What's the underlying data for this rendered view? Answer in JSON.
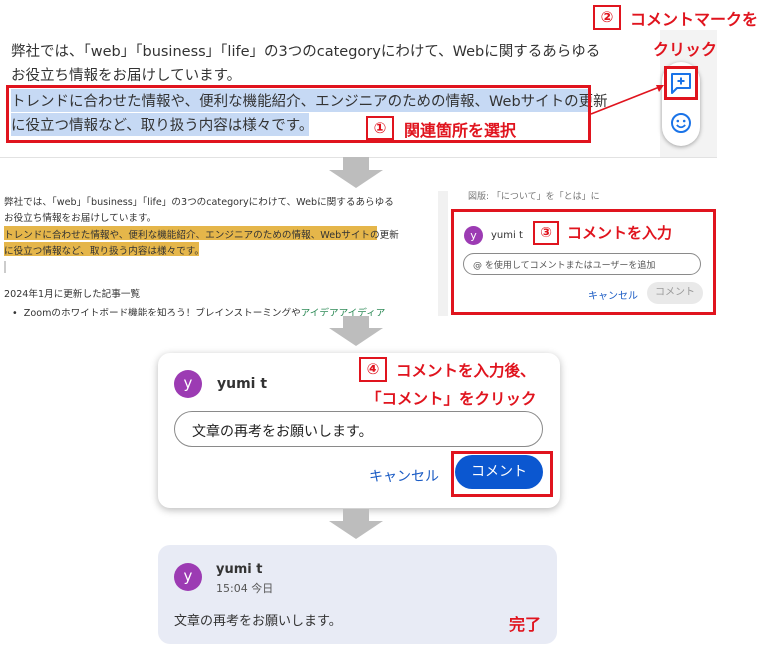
{
  "step1": {
    "line1": "弊社では、「web」「business」「life」の3つのcategoryにわけて、Webに関するあらゆる",
    "line2": "お役立ち情報をお届けしています。",
    "sel1": "トレンドに合わせた情報や、便利な機能紹介、エンジニアのための情報、Webサイトの更新",
    "sel2": "に役立つ情報など、取り扱う内容は様々です。",
    "callout_num": "①",
    "callout_text": "関連箇所を選択",
    "comment_icon": "add-comment-icon",
    "emoji_icon": "emoji-icon"
  },
  "step2": {
    "callout_num": "②",
    "callout_line1": "コメントマークを",
    "callout_line2": "クリック"
  },
  "step3": {
    "line1": "弊社では、「web」「business」「life」の3つのcategoryにわけて、Webに関するあらゆる",
    "line2": "お役立ち情報をお届けしています。",
    "sel1": "トレンドに合わせた情報や、便利な機能紹介、エンジニアのための情報、Webサイトの更新",
    "sel2": "に役立つ情報など、取り扱う内容は様々です。",
    "updated": "2024年1月に更新した記事一覧",
    "bullet_prefix": "Zoomのホワイトボード機能を知ろう！ブレインストーミングや",
    "bullet_link": "アイデアアイディア",
    "top_partial": "図版: 「について」を「とは」に",
    "user_initial": "y",
    "user_name": "yumi t",
    "input_placeholder": "@ を使用してコメントまたはユーザーを追加",
    "cancel": "キャンセル",
    "comment": "コメント",
    "callout_num": "③",
    "callout_text": "コメントを入力"
  },
  "step4": {
    "user_initial": "y",
    "user_name": "yumi t",
    "input_value": "文章の再考をお願いします。",
    "cancel": "キャンセル",
    "comment": "コメント",
    "callout_num": "④",
    "callout_line1": "コメントを入力後、",
    "callout_line2": "「コメント」をクリック"
  },
  "step5": {
    "user_initial": "y",
    "user_name": "yumi t",
    "time": "15:04 今日",
    "body": "文章の再考をお願いします。",
    "done": "完了"
  },
  "colors": {
    "accent_red": "#e0141e",
    "google_blue": "#0b57d0",
    "avatar_purple": "#9c3bb3",
    "selection_blue": "#c6d9f4",
    "selection_gold": "#e5b64a"
  }
}
